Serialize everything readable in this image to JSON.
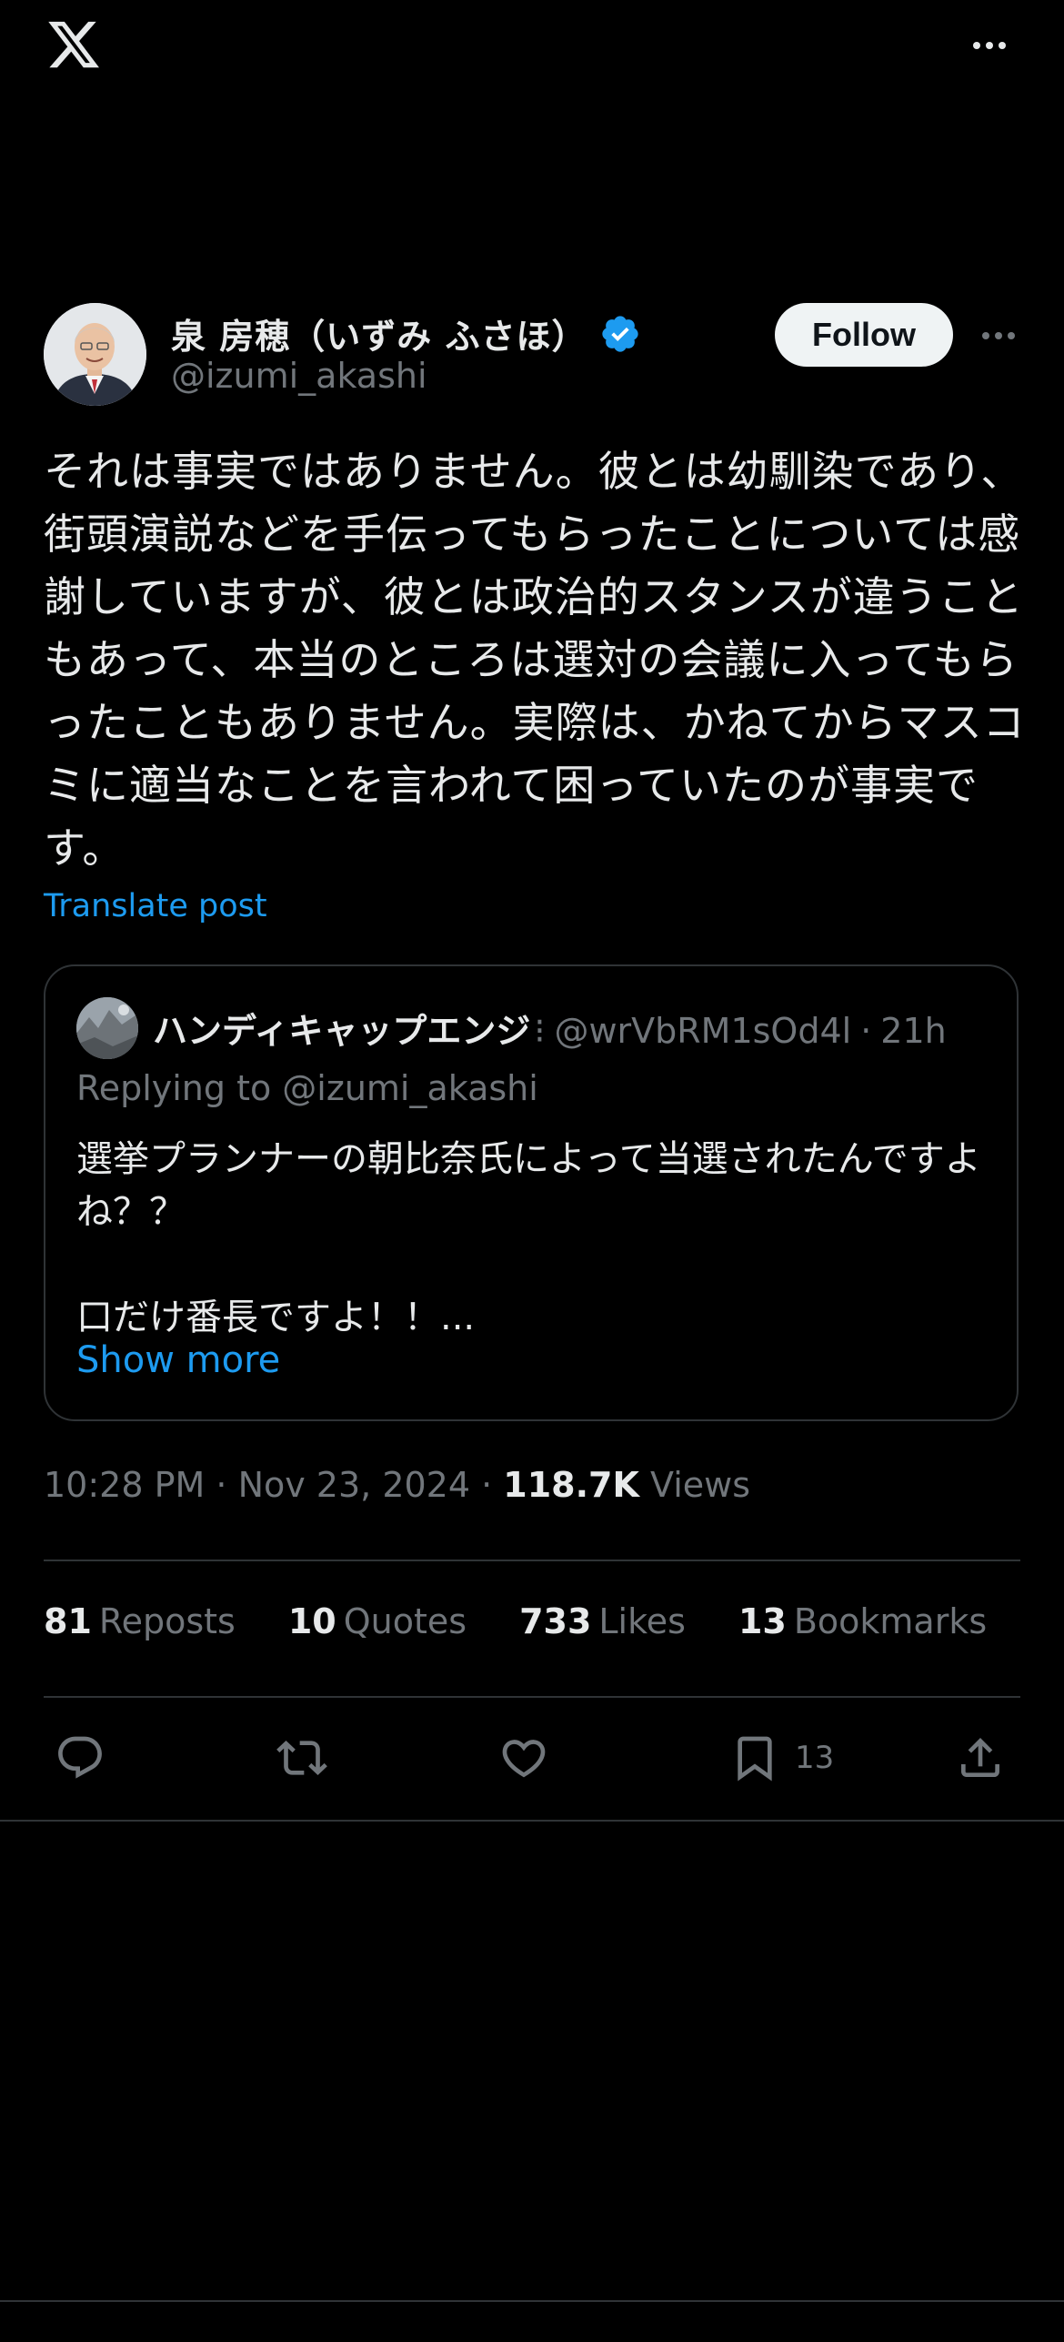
{
  "post": {
    "author": {
      "display_name": "泉 房穂（いずみ ふさほ）",
      "handle": "@izumi_akashi",
      "verified": true
    },
    "follow_label": "Follow",
    "text": "それは事実ではありません。彼とは幼馴染であり、街頭演説などを手伝ってもらったことについては感謝していますが、彼とは政治的スタンスが違うこともあって、本当のところは選対の会議に入ってもらったこともありません。実際は、かねてからマスコミに適当なことを言われて困っていたのが事実です。",
    "translate_label": "Translate post",
    "quote": {
      "name": "ハンディキャップエンジ",
      "handle": "@wrVbRM1sOd4l",
      "time": "21h",
      "replying_to": "Replying to @izumi_akashi",
      "text": "選挙プランナーの朝比奈氏によって当選されたんですよね？？\n\n口だけ番長ですよ！！...",
      "show_more": "Show more"
    },
    "meta": {
      "time": "10:28 PM",
      "date": "Nov 23, 2024",
      "views_count": "118.7K",
      "views_label": "Views"
    },
    "stats": {
      "reposts": {
        "count": "81",
        "label": "Reposts"
      },
      "quotes": {
        "count": "10",
        "label": "Quotes"
      },
      "likes": {
        "count": "733",
        "label": "Likes"
      },
      "bookmarks": {
        "count": "13",
        "label": "Bookmarks"
      }
    },
    "actions": {
      "bookmark_count": "13"
    }
  },
  "colors": {
    "background": "#000000",
    "text": "#e7e9ea",
    "secondary": "#71767b",
    "accent": "#1d9bf0",
    "divider": "#2f3336"
  },
  "icons": [
    "x-logo-icon",
    "more-icon",
    "verified-badge-icon",
    "reply-icon",
    "repost-icon",
    "like-icon",
    "bookmark-icon",
    "share-icon"
  ]
}
